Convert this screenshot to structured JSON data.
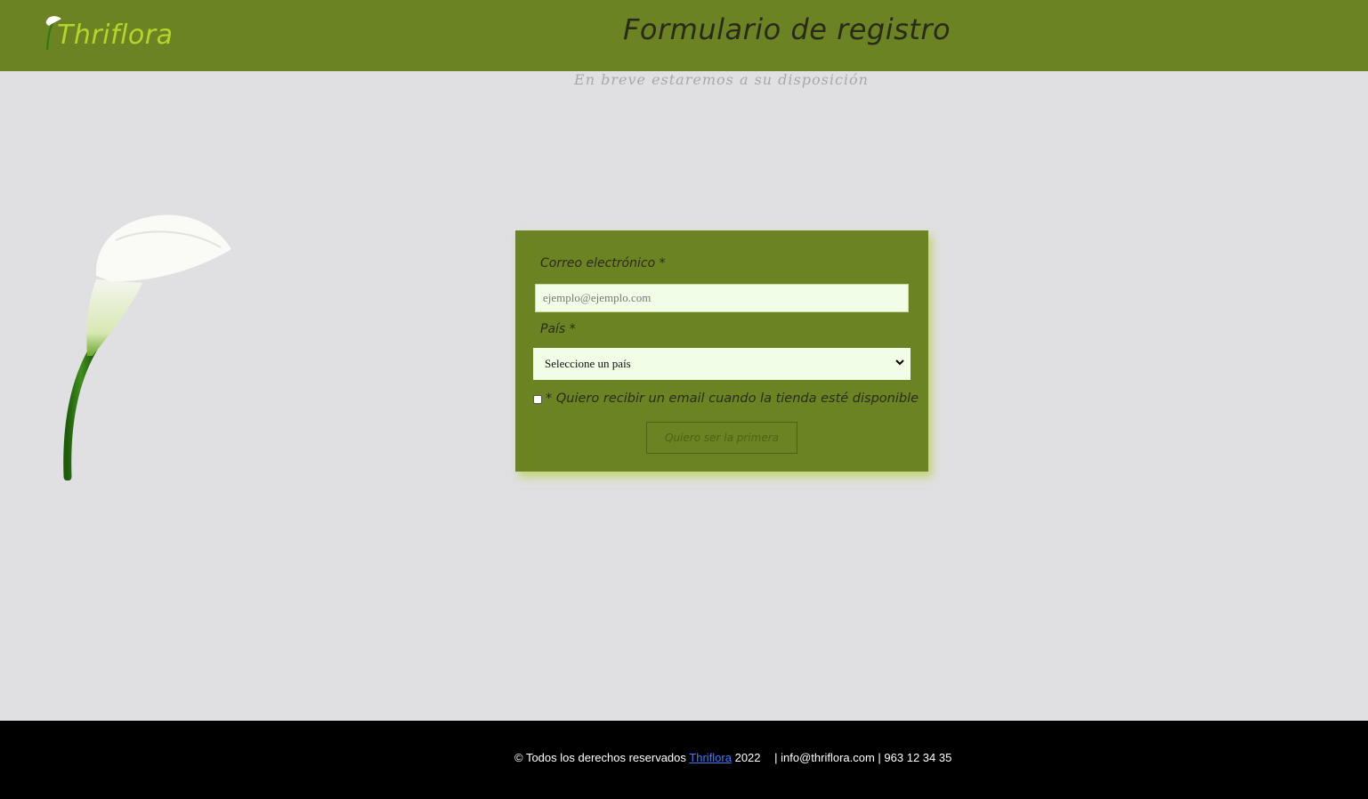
{
  "header": {
    "brand_name": "Thriflora",
    "page_title": "Formulario de registro"
  },
  "subtitle": "En breve estaremos a su disposición",
  "form": {
    "email_label": "Correo electrónico *",
    "email_placeholder": "ejemplo@ejemplo.com",
    "country_label": "País *",
    "country_selected": "Seleccione un país",
    "consent_checked": false,
    "consent_label": "* Quiero recibir un email cuando la tienda esté disponible",
    "submit_label": "Quiero ser la primera"
  },
  "footer": {
    "copyright": "© Todos los derechos reservados",
    "brand_link": "Thriflora",
    "year": "2022",
    "contact": "| info@thriflora.com | 963 12 34 35"
  },
  "colors": {
    "header_bg": "#6b8322",
    "brand_text": "#b4d62a",
    "page_bg": "#e0e0e2",
    "input_bg": "#f1fde6",
    "footer_bg": "#000000",
    "link": "#3b7bff"
  },
  "icons": [
    "calla-lily-logo-icon",
    "calla-lily-illustration",
    "chevron-down-icon"
  ]
}
